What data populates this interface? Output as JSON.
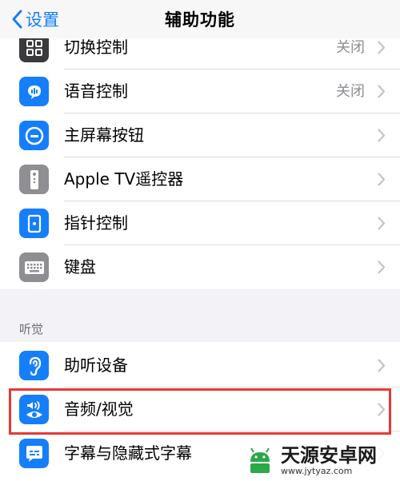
{
  "nav": {
    "back_label": "设置",
    "title": "辅助功能"
  },
  "group1": [
    {
      "label": "切换控制",
      "value": "关闭",
      "icon": "switch-control-icon",
      "color": "#3a3a3c"
    },
    {
      "label": "语音控制",
      "value": "关闭",
      "icon": "voice-control-icon",
      "color": "#147efb"
    },
    {
      "label": "主屏幕按钮",
      "value": "",
      "icon": "home-button-icon",
      "color": "#147efb"
    },
    {
      "label": "Apple TV遥控器",
      "value": "",
      "icon": "tv-remote-icon",
      "color": "#8e8e93"
    },
    {
      "label": "指针控制",
      "value": "",
      "icon": "pointer-control-icon",
      "color": "#147efb"
    },
    {
      "label": "键盘",
      "value": "",
      "icon": "keyboard-icon",
      "color": "#8e8e93"
    }
  ],
  "section_header": "听觉",
  "group2": [
    {
      "label": "助听设备",
      "value": "",
      "icon": "ear-icon",
      "color": "#147efb"
    },
    {
      "label": "音频/视觉",
      "value": "",
      "icon": "audio-visual-icon",
      "color": "#147efb"
    },
    {
      "label": "字幕与隐藏式字幕",
      "value": "",
      "icon": "subtitles-icon",
      "color": "#147efb"
    }
  ],
  "watermark": {
    "title": "天源安卓网",
    "url": "www.jytyaz.com"
  },
  "colors": {
    "accent": "#147efb",
    "highlight": "#e53935"
  }
}
